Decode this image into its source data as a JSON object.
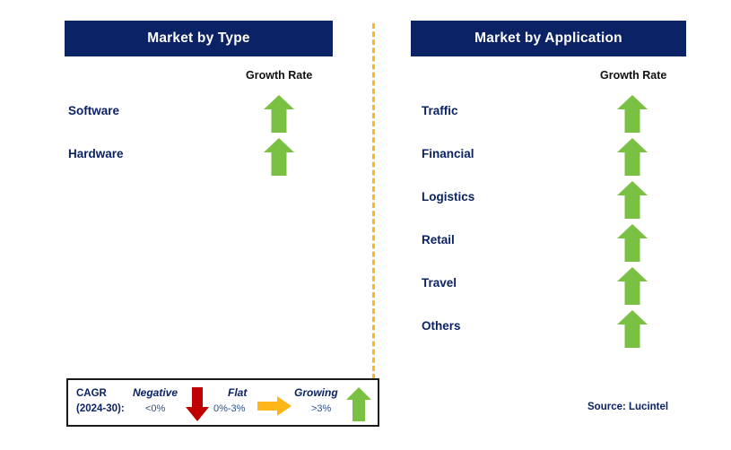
{
  "colors": {
    "header_bg": "#0b2265",
    "header_text": "#ffffff",
    "label_text": "#0b2265",
    "arrow_up": "#7ac143",
    "arrow_down": "#c00000",
    "arrow_flat": "#ffb619",
    "divider": "#ffb619",
    "legend_border": "#1a1a1a"
  },
  "panels": [
    {
      "id": "type",
      "title": "Market by Type",
      "growth_rate_label": "Growth Rate",
      "rows": [
        {
          "label": "Software",
          "growth": "up"
        },
        {
          "label": "Hardware",
          "growth": "up"
        }
      ]
    },
    {
      "id": "application",
      "title": "Market by Application",
      "growth_rate_label": "Growth Rate",
      "rows": [
        {
          "label": "Traffic",
          "growth": "up"
        },
        {
          "label": "Financial",
          "growth": "up"
        },
        {
          "label": "Logistics",
          "growth": "up"
        },
        {
          "label": "Retail",
          "growth": "up"
        },
        {
          "label": "Travel",
          "growth": "up"
        },
        {
          "label": "Others",
          "growth": "up"
        }
      ]
    }
  ],
  "legend": {
    "cagr_line1": "CAGR",
    "cagr_line2": "(2024-30):",
    "items": [
      {
        "title": "Negative",
        "value": "<0%",
        "icon": "arrow-down-icon"
      },
      {
        "title": "Flat",
        "value": "0%-3%",
        "icon": "arrow-right-icon"
      },
      {
        "title": "Growing",
        "value": ">3%",
        "icon": "arrow-up-icon"
      }
    ]
  },
  "source": "Source: Lucintel"
}
